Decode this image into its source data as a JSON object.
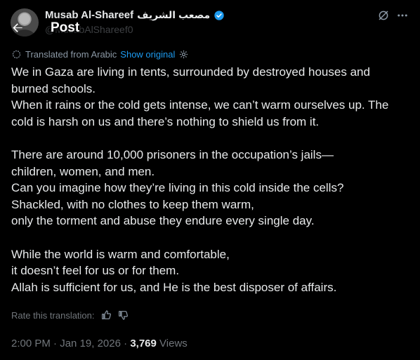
{
  "header": {
    "display_name": "Musab Al-Shareef",
    "arabic_name": "مصعب الشريف",
    "handle": "@MusabAlShareef0",
    "title": "Post"
  },
  "translation": {
    "label": "Translated from Arabic",
    "show_original": "Show original"
  },
  "post": {
    "paragraphs": [
      [
        "We in Gaza are living in tents, surrounded by destroyed houses and",
        "burned schools.",
        "When it rains or the cold gets intense, we can’t warm ourselves up. The",
        "cold is harsh on us and there’s nothing to shield us from it."
      ],
      [
        "There are around 10,000 prisoners in the occupation’s jails—",
        "children, women, and men.",
        "Can you imagine how they’re living in this cold inside the cells?",
        "Shackled, with no clothes to keep them warm,",
        "only the torment and abuse they endure every single day."
      ],
      [
        "While the world is warm and comfortable,",
        "it doesn’t feel for us or for them.",
        "Allah is sufficient for us, and He is the best disposer of affairs."
      ]
    ]
  },
  "rate": {
    "label": "Rate this translation:"
  },
  "meta": {
    "time": "2:00 PM",
    "separator": "·",
    "date": "Jan 19, 2026",
    "views_count": "3,769",
    "views_label": "Views"
  },
  "colors": {
    "accent": "#1d9bf0",
    "background": "#000000",
    "text": "#e7e9ea",
    "muted": "#71767b"
  },
  "icons": [
    "back-arrow-icon",
    "verified-badge-icon",
    "grok-icon",
    "more-icon",
    "translate-icon",
    "settings-icon",
    "thumbs-up-icon",
    "thumbs-down-icon"
  ]
}
